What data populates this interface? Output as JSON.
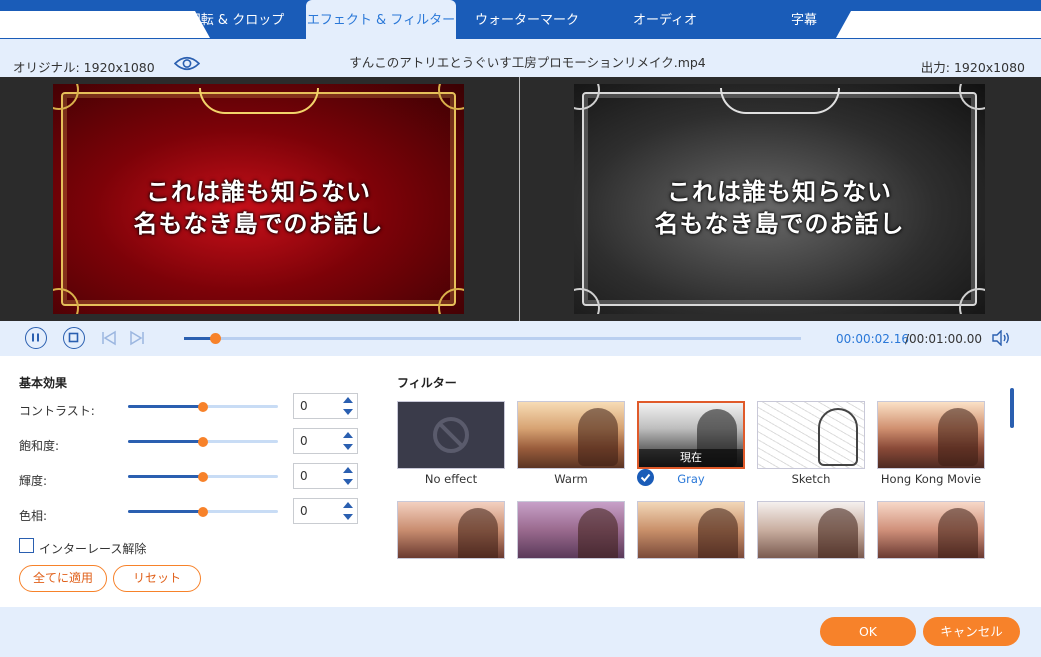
{
  "tabs": [
    {
      "label": "回転 & クロップ",
      "active": false
    },
    {
      "label": "エフェクト & フィルター",
      "active": true
    },
    {
      "label": "ウォーターマーク",
      "active": false
    },
    {
      "label": "オーディオ",
      "active": false
    },
    {
      "label": "字幕",
      "active": false
    }
  ],
  "info": {
    "original": "オリジナル: 1920x1080",
    "filename": "すんこのアトリエとうぐいす工房プロモーションリメイク.mp4",
    "output": "出力: 1920x1080"
  },
  "preview": {
    "line1": "これは誰も知らない",
    "line2": "名もなき島でのお話し"
  },
  "playback": {
    "current_time": "00:00:02.16",
    "total_time": "/00:01:00.00",
    "progress": 0.05
  },
  "basic": {
    "title": "基本効果",
    "adjustments": [
      {
        "label": "コントラスト:",
        "value": "0",
        "level": 0.5
      },
      {
        "label": "飽和度:",
        "value": "0",
        "level": 0.5
      },
      {
        "label": "輝度:",
        "value": "0",
        "level": 0.5
      },
      {
        "label": "色相:",
        "value": "0",
        "level": 0.5
      }
    ],
    "deinterlace_label": "インターレース解除",
    "deinterlace_checked": false,
    "apply_all": "全てに適用",
    "reset": "リセット"
  },
  "filters": {
    "title": "フィルター",
    "current_label": "現在",
    "items": [
      {
        "name": "No effect",
        "style": "none",
        "selected": false
      },
      {
        "name": "Warm",
        "style": "warm",
        "selected": false
      },
      {
        "name": "Gray",
        "style": "gray",
        "selected": true
      },
      {
        "name": "Sketch",
        "style": "sketch",
        "selected": false
      },
      {
        "name": "Hong Kong Movie",
        "style": "hk",
        "selected": false
      },
      {
        "name": "",
        "style": "r2a",
        "selected": false
      },
      {
        "name": "",
        "style": "r2b",
        "selected": false
      },
      {
        "name": "",
        "style": "r2c",
        "selected": false
      },
      {
        "name": "",
        "style": "r2d",
        "selected": false
      },
      {
        "name": "",
        "style": "r2e",
        "selected": false
      }
    ]
  },
  "footer": {
    "ok": "OK",
    "cancel": "キャンセル"
  },
  "colors": {
    "header_blue": "#1a5cb8",
    "accent_orange": "#f7822a",
    "accent_blue": "#2a78d8"
  }
}
